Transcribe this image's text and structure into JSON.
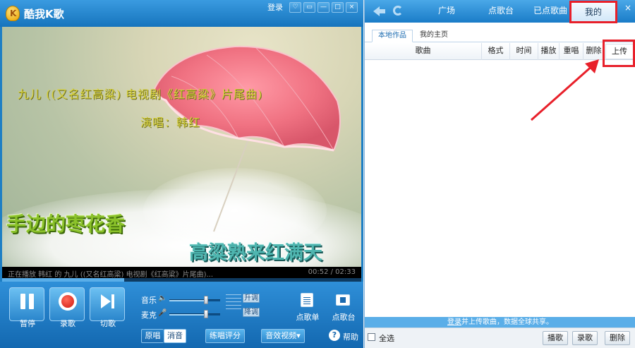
{
  "player": {
    "app_title": "酷我K歌",
    "login": "登录",
    "title_buttons": [
      "♡",
      "▭",
      "—",
      "□",
      "×"
    ],
    "video": {
      "subtitle_title": "九儿 ((又名红高粱) 电视剧《红高粱》片尾曲)",
      "subtitle_singer": "演唱：韩红",
      "lyric_line_1": "手边的枣花香",
      "lyric_line_2": "高粱熟来红满天"
    },
    "status": {
      "now_playing": "正在播放 韩红 的 九儿 ((又名红高粱) 电视剧《红高粱》片尾曲)...",
      "time": "00:52 / 02:33",
      "progress": 0.34
    },
    "controls": {
      "pause_label": "暂停",
      "record_label": "录歌",
      "next_label": "切歌",
      "music_label": "音乐",
      "mic_label": "麦克",
      "music_level": 0.72,
      "mic_level": 0.72,
      "pitch_up": "升调",
      "pitch_down": "降调",
      "songlist_label": "点歌单",
      "stage_label": "点歌台"
    },
    "bottom": {
      "original": "原唱",
      "mute": "消音",
      "practice": "练唱评分",
      "effects": "音效视频▾",
      "help": "帮助",
      "help_icon": "?"
    }
  },
  "panel": {
    "nav_tabs": [
      "广场",
      "点歌台",
      "已点歌曲",
      "我的"
    ],
    "active_tab": "我的",
    "close": "×",
    "subtabs": [
      "本地作品",
      "我的主页"
    ],
    "columns": [
      "歌曲",
      "格式",
      "时间",
      "播放",
      "重唱",
      "删除"
    ],
    "upload": "上传",
    "notice_link": "登录",
    "notice_text": "并上传歌曲，数据全球共享。",
    "select_all": "全选",
    "footer_buttons": [
      "播歌",
      "录歌",
      "删除"
    ]
  },
  "colors": {
    "accent": "#1e7fc4",
    "highlight": "#e8202a",
    "lyric_green": "#8bc22a",
    "lyric_teal": "#4fb6b0"
  }
}
